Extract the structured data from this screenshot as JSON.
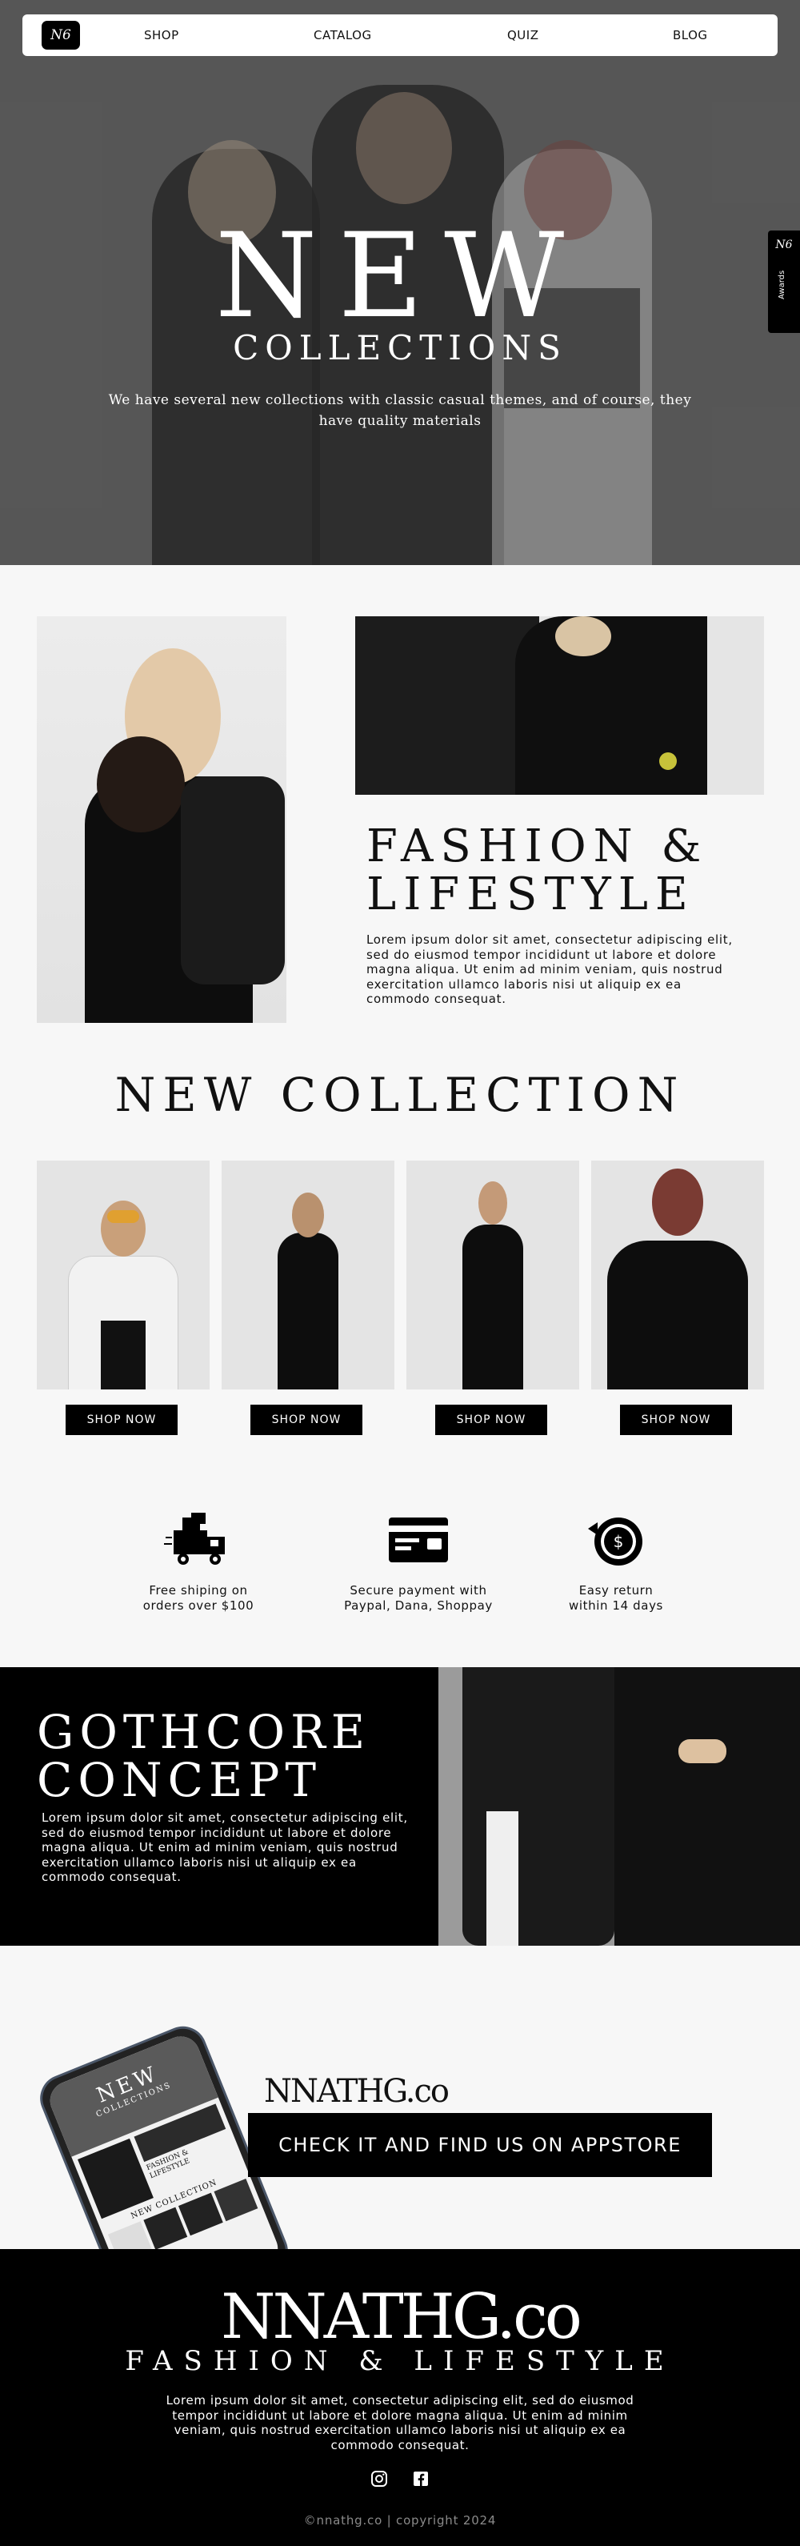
{
  "nav": {
    "logo": "N6",
    "links": [
      "SHOP",
      "CATALOG",
      "QUIZ",
      "BLOG"
    ]
  },
  "hero": {
    "title": "NEW",
    "subtitle": "COLLECTIONS",
    "description": "We have several new collections with classic casual themes, and of course, they have quality materials"
  },
  "awards": {
    "logo": "N6",
    "label": "Awards"
  },
  "fashion": {
    "title_line1": "FASHION &",
    "title_line2": "LIFESTYLE",
    "text": "Lorem ipsum dolor sit amet, consectetur adipiscing elit, sed do eiusmod tempor incididunt ut labore et dolore magna aliqua. Ut enim ad minim veniam, quis nostrud exercitation ullamco laboris nisi ut aliquip ex ea commodo consequat."
  },
  "new_collection": {
    "title": "NEW COLLECTION",
    "button_label": "SHOP NOW",
    "products": [
      {
        "button": "SHOP NOW"
      },
      {
        "button": "SHOP NOW"
      },
      {
        "button": "SHOP NOW"
      },
      {
        "button": "SHOP NOW"
      }
    ]
  },
  "features": [
    {
      "icon": "delivery-truck-icon",
      "line1": "Free shiping on",
      "line2": "orders over $100"
    },
    {
      "icon": "payment-card-icon",
      "line1": "Secure payment with",
      "line2": "Paypal, Dana, Shoppay"
    },
    {
      "icon": "return-coin-icon",
      "line1": "Easy return",
      "line2": "within 14 days"
    }
  ],
  "gothcore": {
    "title_line1": "GOTHCORE",
    "title_line2": "CONCEPT",
    "text": "Lorem ipsum dolor sit amet, consectetur adipiscing elit, sed do eiusmod tempor incididunt ut labore et dolore magna aliqua. Ut enim ad minim veniam, quis nostrud exercitation ullamco laboris nisi ut aliquip ex ea commodo consequat."
  },
  "app": {
    "brand": "NNATHG.co",
    "cta": "CHECK IT AND FIND US ON APPSTORE",
    "phone_screen": {
      "hero_title": "NEW",
      "hero_subtitle": "COLLECTIONS",
      "section_title": "FASHION & LIFESTYLE",
      "collection_title": "NEW COLLECTION"
    }
  },
  "footer": {
    "brand": "NNATHG.co",
    "tagline": "FASHION & LIFESTYLE",
    "text": "Lorem ipsum dolor sit amet, consectetur adipiscing elit, sed do eiusmod tempor incididunt ut labore et dolore magna aliqua. Ut enim ad minim veniam, quis nostrud exercitation ullamco laboris nisi ut aliquip ex ea commodo consequat.",
    "copyright": "©nnathg.co | copyright 2024"
  },
  "colors": {
    "black": "#000000",
    "background": "#f7f7f7",
    "hero_gray": "#5a5a5a",
    "footer_copy": "#8a8a8a"
  }
}
